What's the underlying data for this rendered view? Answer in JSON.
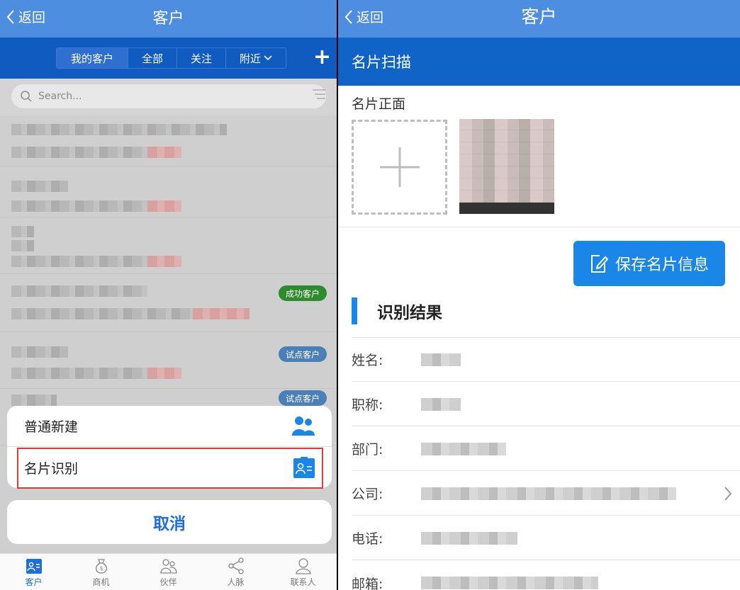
{
  "left": {
    "header": {
      "back_label": "返回",
      "title": "客户"
    },
    "segments": [
      {
        "label": "我的客户",
        "active": true
      },
      {
        "label": "全部",
        "active": false
      },
      {
        "label": "关注",
        "active": false
      },
      {
        "label": "附近",
        "active": false,
        "dropdown": true
      }
    ],
    "add_icon": "plus-icon",
    "search": {
      "placeholder": "Search...",
      "icon": "search-icon",
      "filter_icon": "menu-icon"
    },
    "badges": [
      {
        "label": "成功客户",
        "color": "#2e8c2e"
      },
      {
        "label": "试点客户",
        "color": "#4a7fb8"
      },
      {
        "label": "试点客户",
        "color": "#4a7fb8"
      }
    ],
    "action_sheet": {
      "items": [
        {
          "label": "普通新建",
          "icon": "people-icon"
        },
        {
          "label": "名片识别",
          "icon": "business-card-icon",
          "highlighted": true
        }
      ],
      "cancel_label": "取消"
    },
    "tabbar": [
      {
        "label": "客户",
        "icon": "contact-card-icon",
        "active": true
      },
      {
        "label": "商机",
        "icon": "money-bag-icon",
        "active": false
      },
      {
        "label": "伙伴",
        "icon": "partners-icon",
        "active": false
      },
      {
        "label": "人脉",
        "icon": "share-network-icon",
        "active": false
      },
      {
        "label": "联系人",
        "icon": "person-icon",
        "active": false
      }
    ]
  },
  "right": {
    "header": {
      "back_label": "返回",
      "title": "客户"
    },
    "section_title": "名片扫描",
    "front_label": "名片正面",
    "save_button": "保存名片信息",
    "result_title": "识别结果",
    "fields": [
      {
        "label": "姓名:"
      },
      {
        "label": "职称:"
      },
      {
        "label": "部门:"
      },
      {
        "label": "公司:",
        "has_chevron": true
      },
      {
        "label": "电话:"
      },
      {
        "label": "邮箱:"
      }
    ]
  },
  "colors": {
    "header_bg": "#4e8ee0",
    "primary": "#1064c8",
    "accent": "#1a86e8",
    "highlight": "#e03b3b"
  }
}
